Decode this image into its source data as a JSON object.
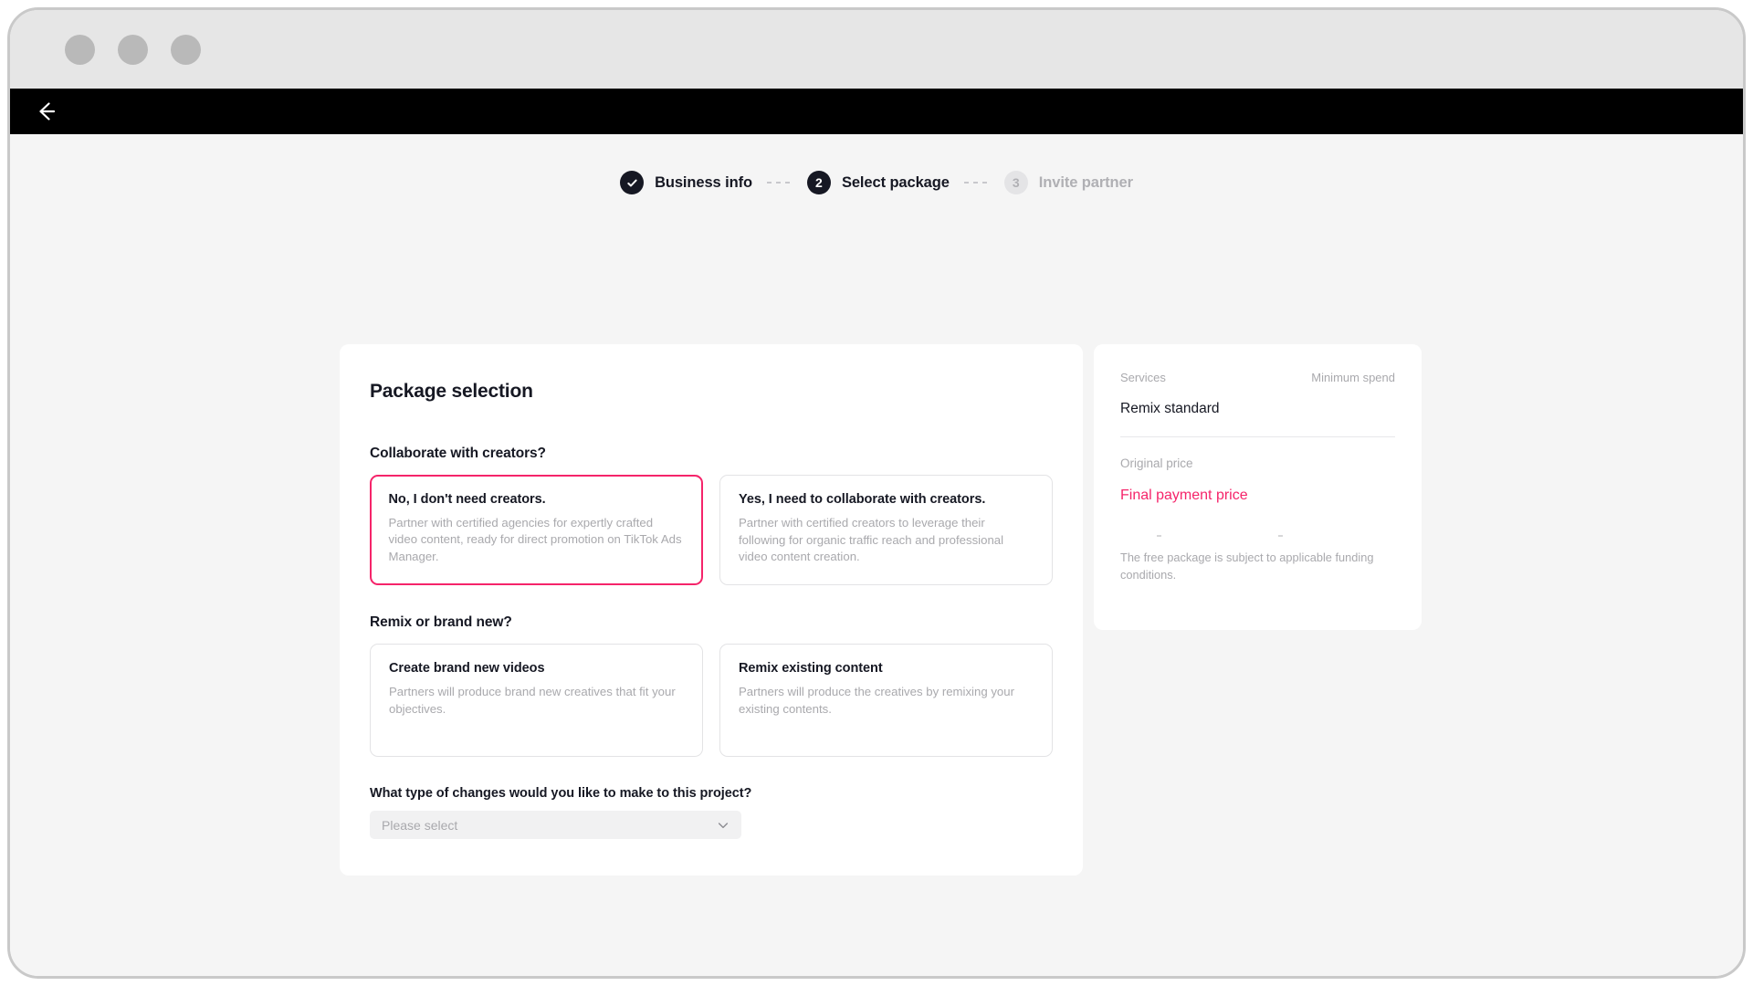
{
  "window": {
    "traffic_lights": [
      "dot-1",
      "dot-2",
      "dot-3"
    ],
    "back_icon": "back-arrow-icon"
  },
  "stepper": {
    "steps": [
      {
        "marker": "check",
        "label": "Business info",
        "state": "done"
      },
      {
        "marker": "2",
        "label": "Select package",
        "state": "current"
      },
      {
        "marker": "3",
        "label": "Invite partner",
        "state": "todo"
      }
    ]
  },
  "main": {
    "title": "Package selection",
    "questions": [
      {
        "label": "Collaborate with creators?",
        "options": [
          {
            "title": "No, I don't need creators.",
            "desc": "Partner with certified agencies for expertly crafted video content, ready for direct promotion on TikTok Ads Manager.",
            "selected": true
          },
          {
            "title": "Yes, I need to collaborate with creators.",
            "desc": "Partner with certified creators to leverage their following for organic traffic reach and professional video content creation.",
            "selected": false
          }
        ]
      },
      {
        "label": "Remix or brand new?",
        "options": [
          {
            "title": "Create brand new videos",
            "desc": "Partners will produce brand new creatives that fit your objectives.",
            "selected": false
          },
          {
            "title": "Remix existing content",
            "desc": "Partners will produce the creatives by remixing your existing contents.",
            "selected": false
          }
        ]
      }
    ],
    "select_field": {
      "label": "What type of changes would you like to make to this project?",
      "value": "Please select",
      "placeholder": "Please select",
      "chevron_icon": "chevron-down-icon"
    }
  },
  "summary": {
    "col_services": "Services",
    "col_minimum_spend": "Minimum spend",
    "service_name": "Remix standard",
    "original_price_label": "Original price",
    "final_price_label": "Final payment price",
    "note": "The free package is subject to applicable funding conditions."
  },
  "colors": {
    "accent_pink": "#f5246a",
    "dark": "#161823",
    "muted": "#a9a9ad",
    "page_bg": "#f5f5f5",
    "topbar": "#000000",
    "titlebar": "#e6e6e6"
  }
}
